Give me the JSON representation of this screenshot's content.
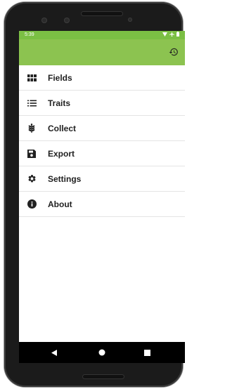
{
  "status_bar": {
    "time": "5:39",
    "color": "#7bbf44"
  },
  "toolbar": {
    "color": "#8cc350",
    "history_icon": "history-icon"
  },
  "menu": {
    "items": [
      {
        "label": "Fields",
        "icon": "grid-icon"
      },
      {
        "label": "Traits",
        "icon": "list-icon"
      },
      {
        "label": "Collect",
        "icon": "wheat-icon"
      },
      {
        "label": "Export",
        "icon": "save-icon"
      },
      {
        "label": "Settings",
        "icon": "gear-icon"
      },
      {
        "label": "About",
        "icon": "info-icon"
      }
    ]
  },
  "nav_bar": {
    "buttons": [
      "back-icon",
      "home-icon",
      "recents-icon"
    ]
  }
}
